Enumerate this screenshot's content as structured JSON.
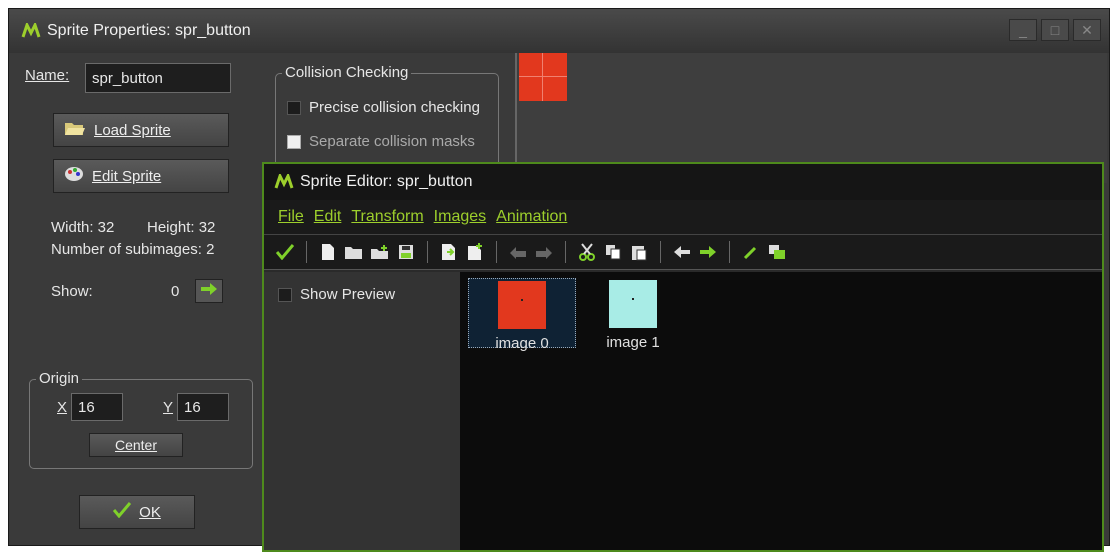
{
  "window": {
    "title": "Sprite Properties: spr_button",
    "buttons": [
      "_",
      "□",
      "✕"
    ]
  },
  "name": {
    "label": "Name:",
    "value": "spr_button"
  },
  "buttons": {
    "load_sprite": "Load Sprite",
    "edit_sprite": "Edit Sprite",
    "ok": "OK",
    "center": "Center"
  },
  "info": {
    "width": "Width: 32",
    "height": "Height: 32",
    "subimages": "Number of subimages: 2",
    "show_label": "Show:",
    "show_value": "0"
  },
  "origin": {
    "legend": "Origin",
    "x_label": "X",
    "x_value": "16",
    "y_label": "Y",
    "y_value": "16"
  },
  "collision": {
    "legend": "Collision Checking",
    "precise": "Precise collision checking",
    "separate": "Separate collision masks"
  },
  "editor": {
    "title": "Sprite Editor: spr_button",
    "menu": [
      "File",
      "Edit",
      "Transform",
      "Images",
      "Animation"
    ],
    "show_preview": "Show Preview",
    "images": [
      {
        "label": "image 0",
        "color": "#e2381e"
      },
      {
        "label": "image 1",
        "color": "#a8ece6"
      }
    ]
  },
  "colors": {
    "accent_green": "#9dcf2c",
    "sprite_red": "#e2381e",
    "sprite_cyan": "#a8ece6"
  }
}
